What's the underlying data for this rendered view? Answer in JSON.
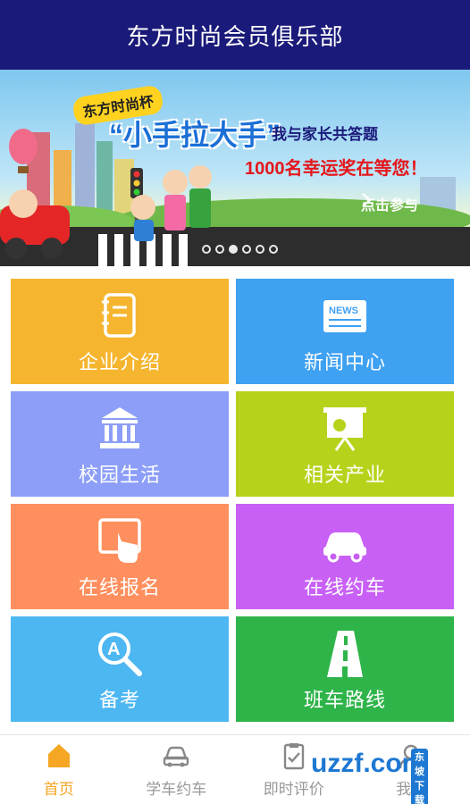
{
  "header": {
    "title": "东方时尚会员俱乐部"
  },
  "banner": {
    "tag": "东方时尚杯",
    "headline": "“小手拉大手”",
    "subtitle": "我与家长共答题",
    "prize": "1000名幸运奖在等您！",
    "cta": "点击参与",
    "slides_total": 6,
    "slides_active": 3
  },
  "tiles": [
    {
      "label": "企业介绍",
      "icon": "notebook-icon",
      "color": "#f5b52e"
    },
    {
      "label": "新闻中心",
      "icon": "news-icon",
      "color": "#3ea1f2"
    },
    {
      "label": "校园生活",
      "icon": "campus-building-icon",
      "color": "#8c9ef7"
    },
    {
      "label": "相关产业",
      "icon": "presentation-board-icon",
      "color": "#b8d21c"
    },
    {
      "label": "在线报名",
      "icon": "touch-screen-icon",
      "color": "#ff8f5e"
    },
    {
      "label": "在线约车",
      "icon": "car-icon",
      "color": "#c860f5"
    },
    {
      "label": "备考",
      "icon": "search-a-icon",
      "color": "#4db7f2"
    },
    {
      "label": "班车路线",
      "icon": "road-icon",
      "color": "#2fb44a"
    }
  ],
  "nav": [
    {
      "label": "首页",
      "icon": "home-icon",
      "active": true
    },
    {
      "label": "学车约车",
      "icon": "car-outline-icon",
      "active": false
    },
    {
      "label": "即时评价",
      "icon": "clipboard-check-icon",
      "active": false
    },
    {
      "label": "我的",
      "icon": "user-icon",
      "active": false
    }
  ],
  "watermark": {
    "text": "uzzf.com",
    "tag": "东坡下载"
  },
  "colors": {
    "header_bg": "#1a1a7a",
    "nav_active": "#f5a623",
    "nav_inactive": "#999999"
  }
}
